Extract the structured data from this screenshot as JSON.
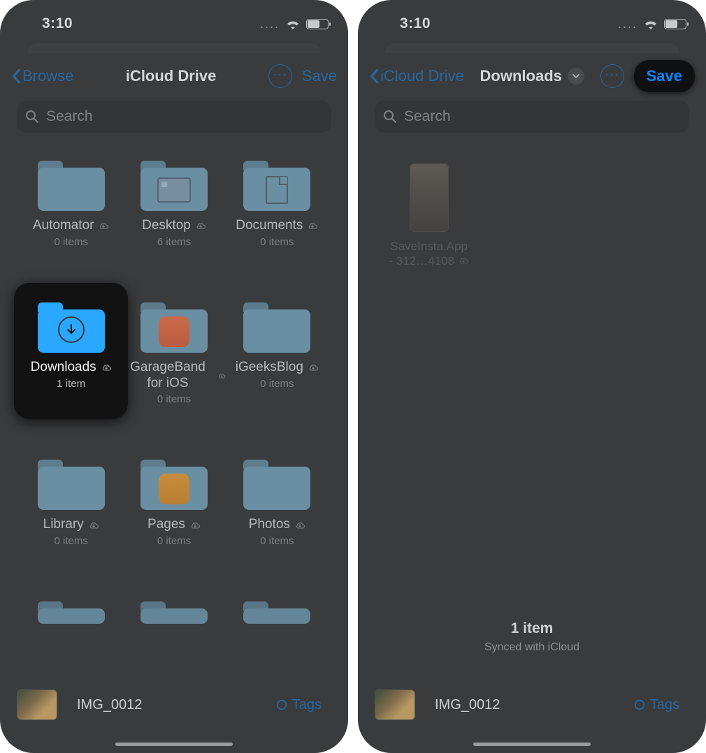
{
  "status": {
    "time": "3:10"
  },
  "left": {
    "back": "Browse",
    "title": "iCloud Drive",
    "save": "Save",
    "search_placeholder": "Search",
    "folders": [
      {
        "name": "Automator",
        "count": "0 items"
      },
      {
        "name": "Desktop",
        "count": "6 items"
      },
      {
        "name": "Documents",
        "count": "0 items"
      },
      {
        "name": "Downloads",
        "count": "1 item",
        "highlight": true
      },
      {
        "name": "GarageBand for iOS",
        "count": "0 items"
      },
      {
        "name": "iGeeksBlog",
        "count": "0 items"
      },
      {
        "name": "Library",
        "count": "0 items"
      },
      {
        "name": "Pages",
        "count": "0 items"
      },
      {
        "name": "Photos",
        "count": "0 items"
      }
    ],
    "filefield": {
      "name": "IMG_0012",
      "tags": "Tags"
    }
  },
  "right": {
    "back": "iCloud Drive",
    "title": "Downloads",
    "save": "Save",
    "search_placeholder": "Search",
    "file": {
      "name": "SaveInsta.App - 312…4108",
      "meta1": "",
      "meta2": ""
    },
    "summary": {
      "items": "1 item",
      "sync": "Synced with iCloud"
    },
    "filefield": {
      "name": "IMG_0012",
      "tags": "Tags"
    }
  }
}
